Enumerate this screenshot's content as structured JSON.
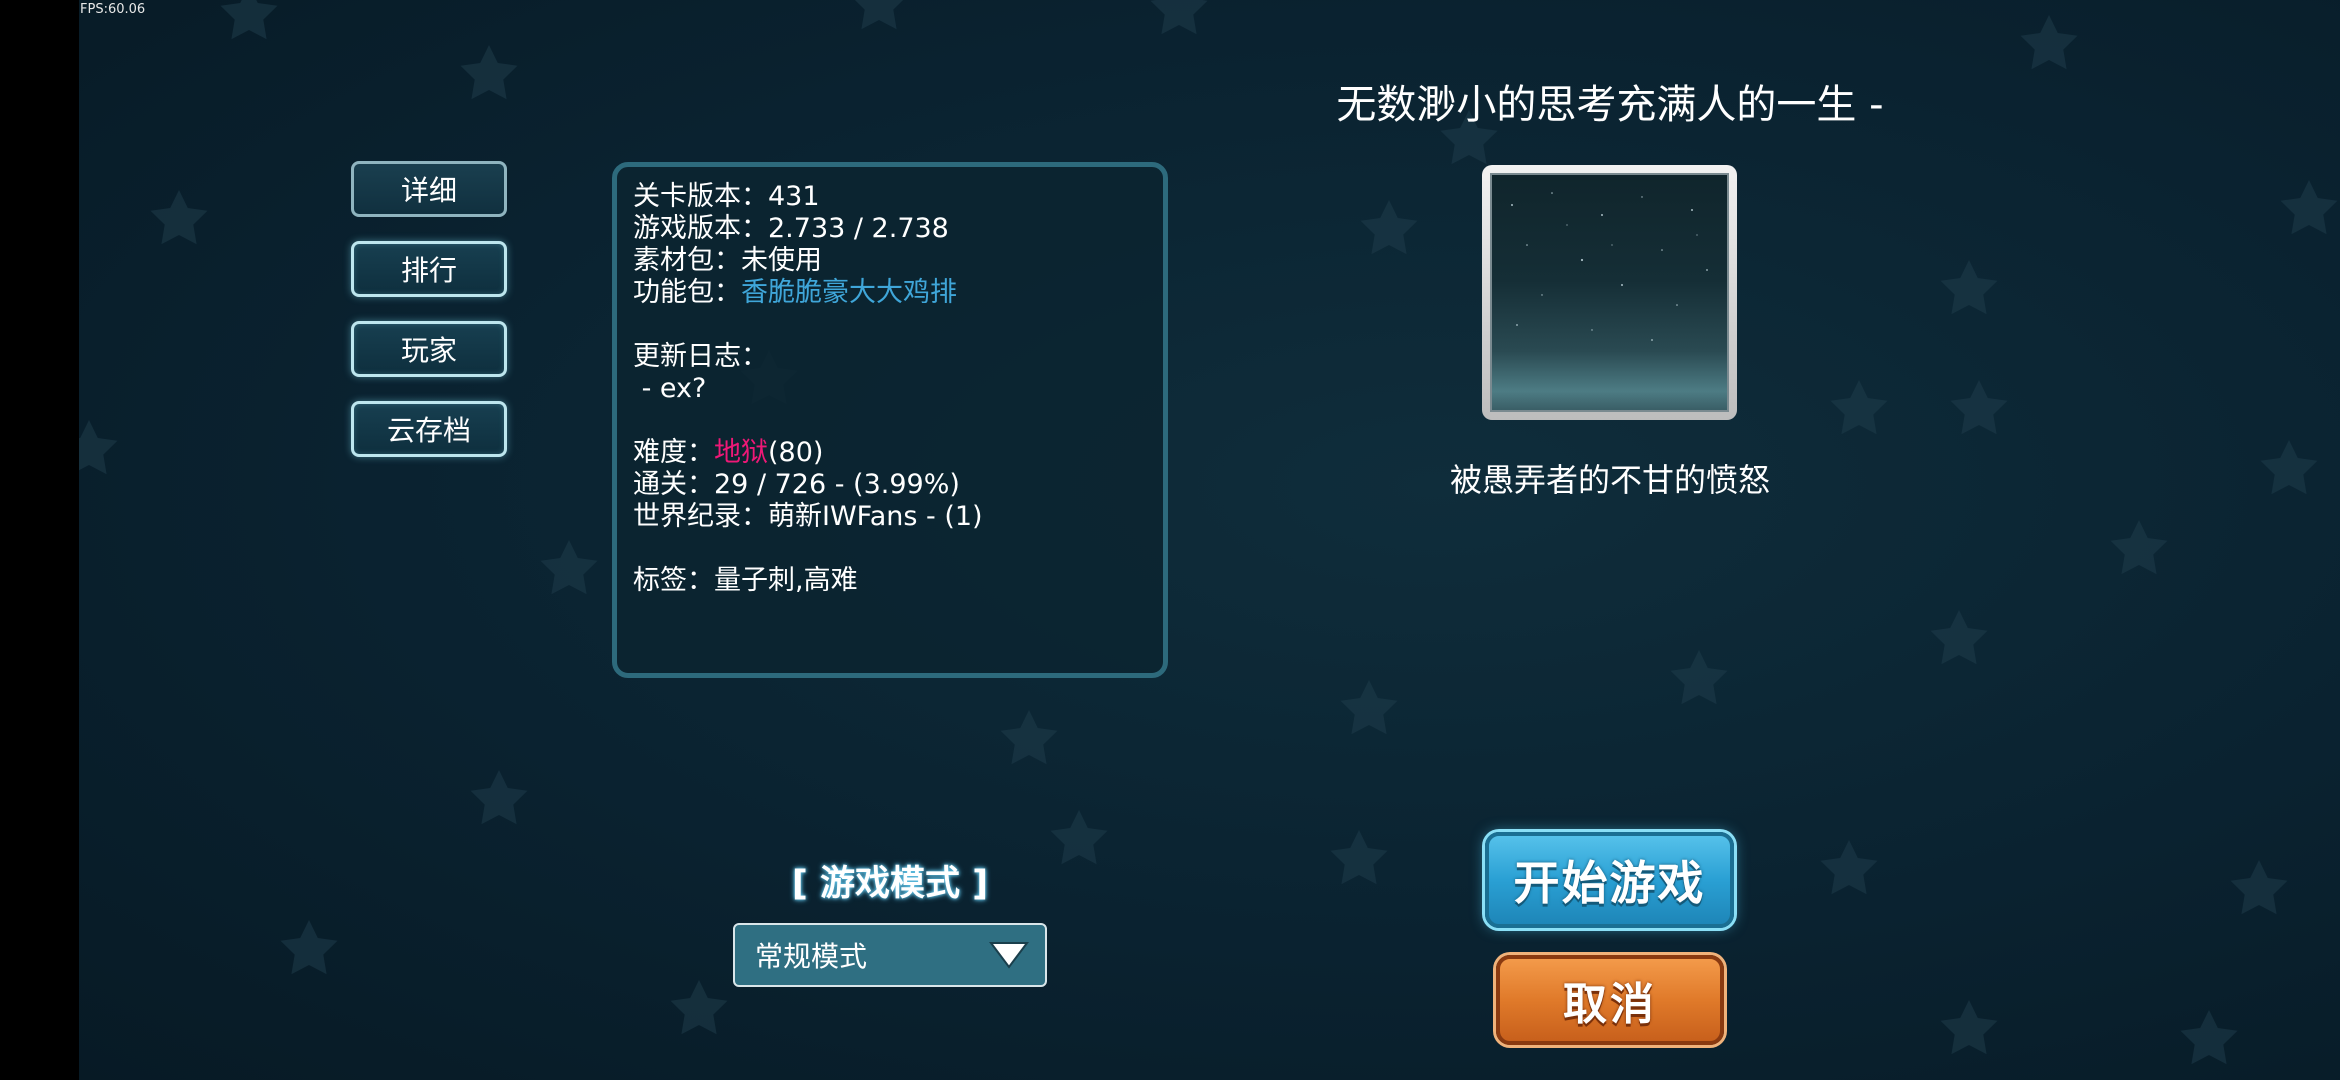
{
  "hud": {
    "fps": "FPS:60.06"
  },
  "side_menu": [
    {
      "label": "详细"
    },
    {
      "label": "排行"
    },
    {
      "label": "玩家"
    },
    {
      "label": "云存档"
    }
  ],
  "info": {
    "level_version_label": "关卡版本：",
    "level_version": "431",
    "game_version_label": "游戏版本：",
    "game_version": "2.733 / 2.738",
    "asset_pack_label": "素材包：",
    "asset_pack": "未使用",
    "feature_pack_label": "功能包：",
    "feature_pack": "香脆脆豪大大鸡排",
    "changelog_label": "更新日志：",
    "changelog": " - ex?",
    "difficulty_label": "难度：",
    "difficulty_name": "地狱",
    "difficulty_value": "(80)",
    "clears_label": "通关：",
    "clears": "29 / 726 - (3.99%)",
    "world_record_label": "世界纪录：",
    "world_record": "萌新IWFans - (1)",
    "tags_label": "标签：",
    "tags": "量子刺,高难"
  },
  "level": {
    "title": "无数渺小的思考充满人的一生 -",
    "subtitle": "被愚弄者的不甘的愤怒"
  },
  "mode": {
    "label": "[ 游戏模式 ]",
    "selected": "常规模式"
  },
  "actions": {
    "start": "开始游戏",
    "cancel": "取消"
  },
  "colors": {
    "feature_pack_link": "#3fa6d9",
    "difficulty_hell": "#ee1877",
    "start_button": "#2aa0d4",
    "cancel_button": "#e07a2a"
  }
}
